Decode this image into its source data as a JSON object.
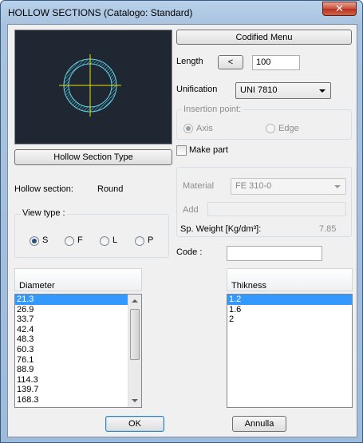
{
  "window": {
    "title": "HOLLOW SECTIONS (Catalogo: Standard)",
    "close_label": "✕"
  },
  "buttons": {
    "codified_menu": "Codified Menu",
    "length_toggle": "<",
    "hollow_section_type": "Hollow Section Type",
    "ok": "OK",
    "cancel": "Annulla"
  },
  "length": {
    "label": "Length",
    "value": "100"
  },
  "unification": {
    "label": "Unification",
    "value": "UNI 7810"
  },
  "insertion_point": {
    "label": "Insertion point:",
    "options": [
      {
        "label": "Axis",
        "checked": true
      },
      {
        "label": "Edge",
        "checked": false
      }
    ]
  },
  "make_part": {
    "label": "Make part",
    "checked": false
  },
  "material": {
    "label": "Material",
    "value": "FE 310-0"
  },
  "add": {
    "label": "Add",
    "value": ""
  },
  "sp_weight": {
    "label": "Sp. Weight [Kg/dm³]:",
    "value": "7.85"
  },
  "code": {
    "label": "Code   :",
    "value": ""
  },
  "hollow_section": {
    "label": "Hollow section:",
    "value": "Round"
  },
  "view_type": {
    "label": "View type  :",
    "options": [
      {
        "label": "S",
        "checked": true
      },
      {
        "label": "F",
        "checked": false
      },
      {
        "label": "L",
        "checked": false
      },
      {
        "label": "P",
        "checked": false
      }
    ]
  },
  "diameter": {
    "header": "Diameter",
    "items": [
      "21.3",
      "26.9",
      "33.7",
      "42.4",
      "48.3",
      "60.3",
      "76.1",
      "88.9",
      "114.3",
      "139.7",
      "168.3"
    ],
    "selected": "21.3"
  },
  "thickness": {
    "header": "Thikness",
    "items": [
      "1.2",
      "1.6",
      "2"
    ],
    "selected": "1.2"
  },
  "colors": {
    "preview_bg": "#1f2733",
    "section_cyan": "#5fd3e6",
    "crosshair_yellow": "#e6e600",
    "selection_blue": "#3399ff"
  }
}
